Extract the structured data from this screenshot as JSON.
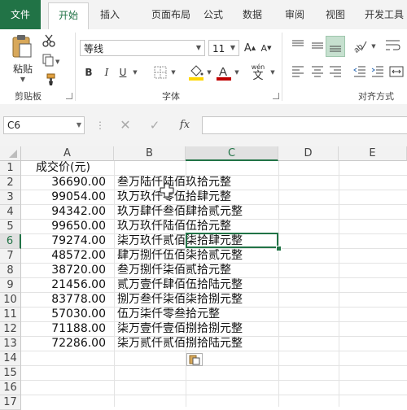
{
  "ribbon_tabs": [
    "文件",
    "开始",
    "插入",
    "页面布局",
    "公式",
    "数据",
    "审阅",
    "视图",
    "开发工具"
  ],
  "clipboard": {
    "paste_label": "粘贴",
    "group_label": "剪贴板"
  },
  "font": {
    "name": "等线",
    "size": "11",
    "group_label": "字体",
    "wen_label": "wén",
    "wen_char": "文"
  },
  "alignment": {
    "group_label": "对齐方式"
  },
  "formula_bar": {
    "name_box": "C6",
    "fx_label": "fx",
    "formula_value": ""
  },
  "columns": [
    "A",
    "B",
    "C",
    "D",
    "E"
  ],
  "selected_cell": "C6",
  "rows": [
    "1",
    "2",
    "3",
    "4",
    "5",
    "6",
    "7",
    "8",
    "9",
    "10",
    "11",
    "12",
    "13",
    "14",
    "15",
    "16",
    "17"
  ],
  "header_a1": "成交价(元)",
  "data": [
    {
      "amount": "36690.00",
      "words": "叁万陆仟陆佰玖拾元整"
    },
    {
      "amount": "99054.00",
      "words": "玖万玖仟零伍拾肆元整"
    },
    {
      "amount": "94342.00",
      "words": "玖万肆仟叁佰肆拾贰元整"
    },
    {
      "amount": "99650.00",
      "words": "玖万玖仟陆佰伍拾元整"
    },
    {
      "amount": "79274.00",
      "words": "柒万玖仟贰佰柒拾肆元整"
    },
    {
      "amount": "48572.00",
      "words": "肆万捌仟伍佰柒拾贰元整"
    },
    {
      "amount": "38720.00",
      "words": "叁万捌仟柒佰贰拾元整"
    },
    {
      "amount": "21456.00",
      "words": "贰万壹仟肆佰伍拾陆元整"
    },
    {
      "amount": "83778.00",
      "words": "捌万叁仟柒佰柒拾捌元整"
    },
    {
      "amount": "57030.00",
      "words": "伍万柒仟零叁拾元整"
    },
    {
      "amount": "71188.00",
      "words": "柒万壹仟壹佰捌拾捌元整"
    },
    {
      "amount": "72286.00",
      "words": "柒万贰仟贰佰捌拾陆元整"
    }
  ],
  "colors": {
    "excel_green": "#217346",
    "fill_yellow": "#ffd700",
    "font_red": "#c00000"
  }
}
